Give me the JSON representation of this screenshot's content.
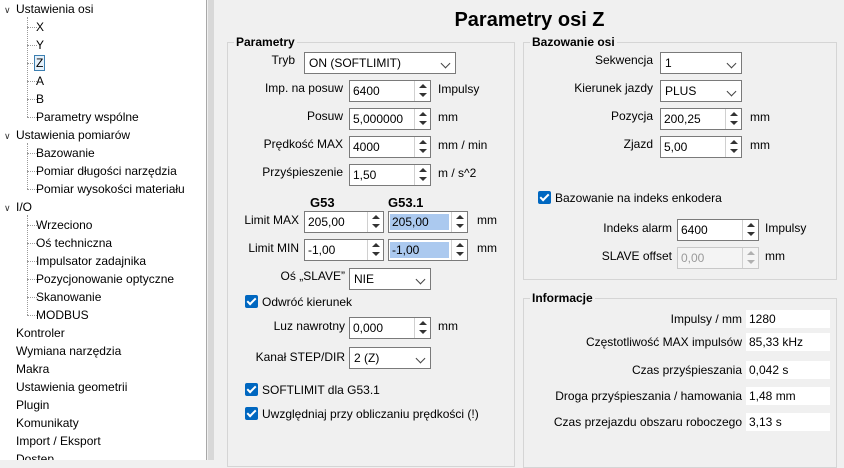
{
  "tree": {
    "sections": [
      {
        "label": "Ustawienia osi",
        "expanded": true,
        "children": [
          "X",
          "Y",
          "Z",
          "A",
          "B",
          "Parametry wspólne"
        ],
        "selected_child": 2
      },
      {
        "label": "Ustawienia pomiarów",
        "expanded": true,
        "children": [
          "Bazowanie",
          "Pomiar długości narzędzia",
          "Pomiar wysokości materiału"
        ]
      },
      {
        "label": "I/O",
        "expanded": true,
        "children": [
          "Wrzeciono",
          "Oś techniczna",
          "Impulsator zadajnika",
          "Pozycjonowanie optyczne",
          "Skanowanie",
          "MODBUS"
        ]
      },
      {
        "label": "Kontroler"
      },
      {
        "label": "Wymiana narzędzia"
      },
      {
        "label": "Makra"
      },
      {
        "label": "Ustawienia geometrii"
      },
      {
        "label": "Plugin"
      },
      {
        "label": "Komunikaty"
      },
      {
        "label": "Import / Eksport"
      },
      {
        "label": "Dostęp"
      }
    ]
  },
  "page": {
    "title": "Parametry osi Z"
  },
  "parametry": {
    "title": "Parametry",
    "tryb": {
      "label": "Tryb",
      "value": "ON (SOFTLIMIT)"
    },
    "imp_na_posuw": {
      "label": "Imp. na posuw",
      "value": "6400",
      "unit": "Impulsy"
    },
    "posuw": {
      "label": "Posuw",
      "value": "5,000000",
      "unit": "mm"
    },
    "predkosc_max": {
      "label": "Prędkość MAX",
      "value": "4000",
      "unit": "mm / min"
    },
    "przyspieszenie": {
      "label": "Przyśpieszenie",
      "value": "1,50",
      "unit": "m / s^2"
    },
    "col_g53": "G53",
    "col_g531": "G53.1",
    "limit_max": {
      "label": "Limit MAX",
      "g53": "205,00",
      "g531": "205,00",
      "unit": "mm"
    },
    "limit_min": {
      "label": "Limit MIN",
      "g53": "-1,00",
      "g531": "-1,00",
      "unit": "mm"
    },
    "os_slave": {
      "label": "Oś „SLAVE”",
      "value": "NIE"
    },
    "odwroc_kierunek": {
      "label": "Odwróć kierunek",
      "checked": true
    },
    "luz_nawrotny": {
      "label": "Luz nawrotny",
      "value": "0,000",
      "unit": "mm"
    },
    "kanal_step_dir": {
      "label": "Kanał STEP/DIR",
      "value": "2 (Z)"
    },
    "softlimit_g531": {
      "label": "SOFTLIMIT dla G53.1",
      "checked": true
    },
    "uwzgledniaj": {
      "label": "Uwzględniaj przy obliczaniu prędkości (!)",
      "checked": true
    }
  },
  "bazowanie": {
    "title": "Bazowanie osi",
    "sekwencja": {
      "label": "Sekwencja",
      "value": "1"
    },
    "kierunek_jazdy": {
      "label": "Kierunek jazdy",
      "value": "PLUS"
    },
    "pozycja": {
      "label": "Pozycja",
      "value": "200,25",
      "unit": "mm"
    },
    "zjazd": {
      "label": "Zjazd",
      "value": "5,00",
      "unit": "mm"
    },
    "bazowanie_enkoder": {
      "label": "Bazowanie na indeks enkodera",
      "checked": true
    },
    "indeks_alarm": {
      "label": "Indeks alarm",
      "value": "6400",
      "unit": "Impulsy"
    },
    "slave_offset": {
      "label": "SLAVE offset",
      "value": "0,00",
      "unit": "mm"
    }
  },
  "informacje": {
    "title": "Informacje",
    "rows": [
      {
        "label": "Impulsy / mm",
        "value": "1280"
      },
      {
        "label": "Częstotliwość MAX impulsów",
        "value": "85,33 kHz"
      },
      {
        "label": "Czas przyśpieszania",
        "value": "0,042 s"
      },
      {
        "label": "Droga przyśpieszania / hamowania",
        "value": "1,48 mm"
      },
      {
        "label": "Czas przejazdu obszaru roboczego",
        "value": "3,13 s"
      }
    ]
  }
}
